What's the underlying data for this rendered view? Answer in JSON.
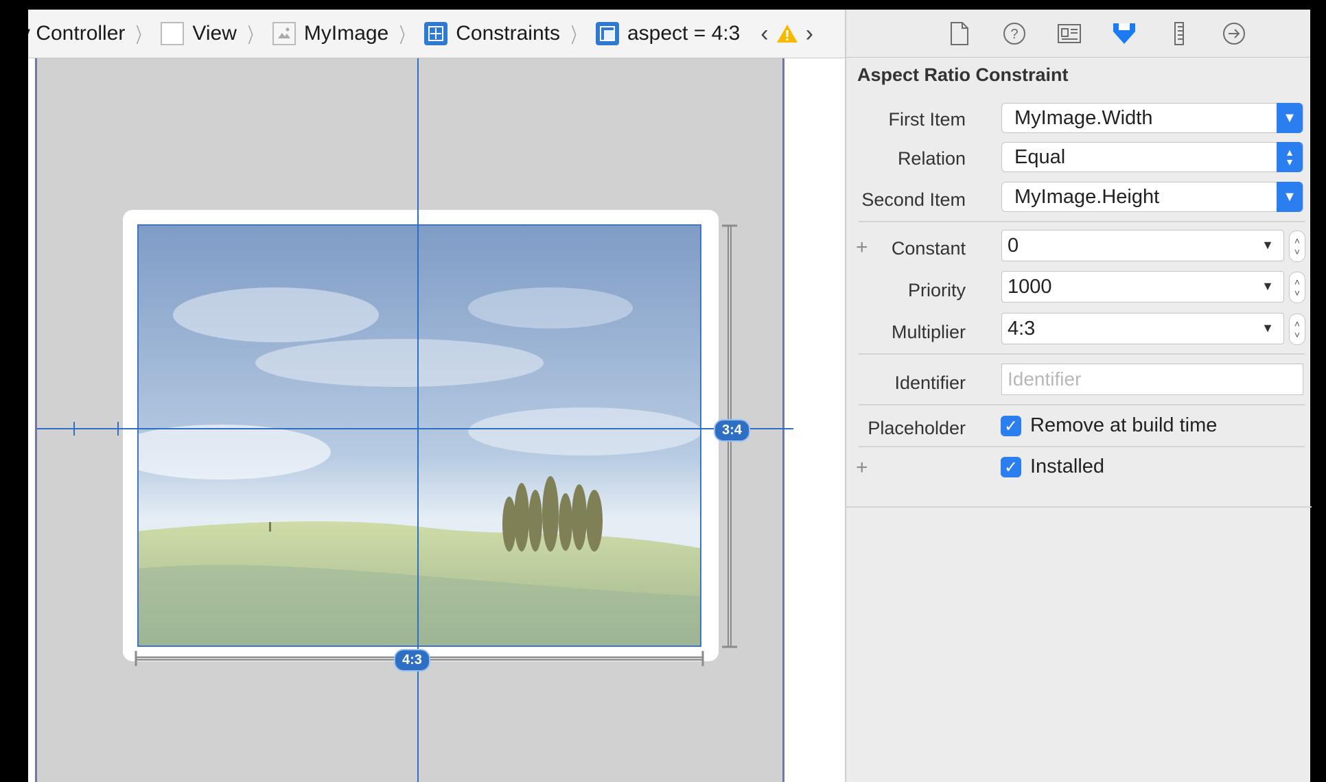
{
  "breadcrumb": {
    "items": [
      {
        "label": "v Controller",
        "icon": "none"
      },
      {
        "label": "View",
        "icon": "view-icon"
      },
      {
        "label": "MyImage",
        "icon": "image-view-icon"
      },
      {
        "label": "Constraints",
        "icon": "constraints-icon"
      },
      {
        "label": "aspect = 4:3",
        "icon": "constraint-icon"
      }
    ],
    "prev_glyph": "‹",
    "next_glyph": "›",
    "warning_icon": "warning-icon"
  },
  "canvas": {
    "height_badge": "3:4",
    "width_badge": "4:3"
  },
  "inspector": {
    "tabs": [
      "file-icon",
      "quick-help-icon",
      "identity-icon",
      "attributes-icon",
      "size-icon",
      "connections-icon"
    ],
    "active_tab": "attributes-icon",
    "section_title": "Aspect Ratio Constraint",
    "first_item": {
      "label": "First Item",
      "value": "MyImage.Width"
    },
    "relation": {
      "label": "Relation",
      "value": "Equal"
    },
    "second_item": {
      "label": "Second Item",
      "value": "MyImage.Height"
    },
    "constant": {
      "label": "Constant",
      "value": "0"
    },
    "priority": {
      "label": "Priority",
      "value": "1000"
    },
    "multiplier": {
      "label": "Multiplier",
      "value": "4:3"
    },
    "identifier": {
      "label": "Identifier",
      "value": "",
      "placeholder": "Identifier"
    },
    "placeholder": {
      "label": "Placeholder",
      "checkbox_label": "Remove at build time",
      "checked": true
    },
    "installed": {
      "label": "Installed",
      "checked": true
    },
    "accent_color": "#2a7ef0"
  }
}
